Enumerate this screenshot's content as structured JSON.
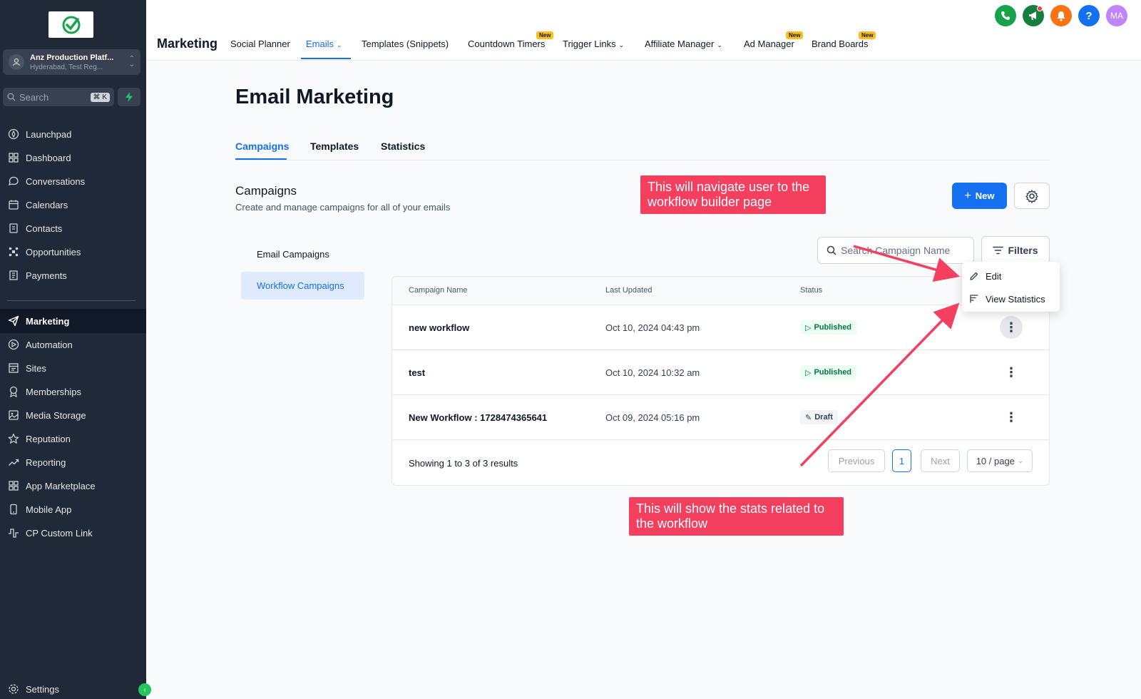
{
  "account": {
    "name": "Anz Production Platf...",
    "location": "Hyderabad, Test Reg..."
  },
  "sidebar_search": {
    "placeholder": "Search",
    "shortcut": "⌘ K"
  },
  "nav": [
    {
      "label": "Launchpad",
      "icon": "rocket-icon"
    },
    {
      "label": "Dashboard",
      "icon": "grid-icon"
    },
    {
      "label": "Conversations",
      "icon": "chat-icon"
    },
    {
      "label": "Calendars",
      "icon": "calendar-icon"
    },
    {
      "label": "Contacts",
      "icon": "contacts-icon"
    },
    {
      "label": "Opportunities",
      "icon": "opportunities-icon"
    },
    {
      "label": "Payments",
      "icon": "payments-icon"
    },
    {
      "label": "Marketing",
      "icon": "send-icon",
      "active": true
    },
    {
      "label": "Automation",
      "icon": "automation-icon"
    },
    {
      "label": "Sites",
      "icon": "sites-icon"
    },
    {
      "label": "Memberships",
      "icon": "award-icon"
    },
    {
      "label": "Media Storage",
      "icon": "image-icon"
    },
    {
      "label": "Reputation",
      "icon": "star-icon"
    },
    {
      "label": "Reporting",
      "icon": "trend-icon"
    },
    {
      "label": "App Marketplace",
      "icon": "apps-icon"
    },
    {
      "label": "Mobile App",
      "icon": "phone-icon"
    },
    {
      "label": "CP Custom Link",
      "icon": "link-icon"
    }
  ],
  "settings_label": "Settings",
  "topbar": {
    "section": "Marketing",
    "tabs": [
      "Social Planner",
      "Emails",
      "Templates (Snippets)",
      "Countdown Timers",
      "Trigger Links",
      "Affiliate Manager",
      "Ad Manager",
      "Brand Boards"
    ],
    "new_badge": "New",
    "avatar_initials": "MA",
    "help": "?"
  },
  "page": {
    "title": "Email Marketing",
    "subtabs": [
      "Campaigns",
      "Templates",
      "Statistics"
    ],
    "campaigns_title": "Campaigns",
    "campaigns_desc": "Create and manage campaigns for all of your emails",
    "new_button": "New",
    "campaign_types": [
      "Email Campaigns",
      "Workflow Campaigns"
    ],
    "search_placeholder": "Search Campaign Name",
    "filters_label": "Filters"
  },
  "table": {
    "headers": [
      "Campaign Name",
      "Last Updated",
      "Status"
    ],
    "rows": [
      {
        "name": "new workflow",
        "updated": "Oct 10, 2024 04:43 pm",
        "status": "Published"
      },
      {
        "name": "test",
        "updated": "Oct 10, 2024 10:32 am",
        "status": "Published"
      },
      {
        "name": "New Workflow : 1728474365641",
        "updated": "Oct 09, 2024 05:16 pm",
        "status": "Draft"
      }
    ],
    "showing": "Showing 1 to 3 of 3 results",
    "prev": "Previous",
    "page": "1",
    "next": "Next",
    "per_page": "10 / page"
  },
  "dropdown": {
    "edit": "Edit",
    "view_statistics": "View Statistics"
  },
  "callouts": {
    "top": "This will navigate user to the workflow builder page",
    "bottom": "This will show the stats related to the workflow"
  },
  "colors": {
    "primary": "#1570ef",
    "sidebar": "#1f2937",
    "callout": "#f43f5e",
    "published": "#067647"
  }
}
